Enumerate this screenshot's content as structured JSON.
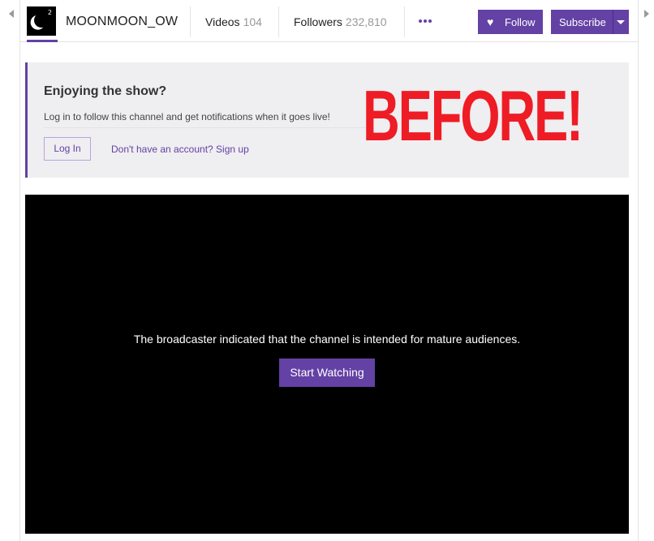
{
  "header": {
    "channel_name": "MOONMOON_OW",
    "avatar_superscript": "2",
    "videos_label": "Videos",
    "videos_count": "104",
    "followers_label": "Followers",
    "followers_count": "232,810",
    "follow_label": "Follow",
    "subscribe_label": "Subscribe"
  },
  "promo": {
    "title": "Enjoying the show?",
    "description": "Log in to follow this channel and get notifications when it goes live!",
    "login_label": "Log In",
    "signup_label": "Don't have an account? Sign up",
    "overlay_text": "BEFORE!"
  },
  "player": {
    "message": "The broadcaster indicated that the channel is intended for mature audiences.",
    "start_label": "Start Watching"
  },
  "icons": [
    "heart-icon",
    "caret-down-icon",
    "more-dots-icon",
    "scroll-left-icon",
    "scroll-right-icon"
  ],
  "colors": {
    "accent": "#6441a4",
    "overlay_red": "#ee1c25",
    "panel_bg": "#efeef1",
    "player_bg": "#000000"
  }
}
